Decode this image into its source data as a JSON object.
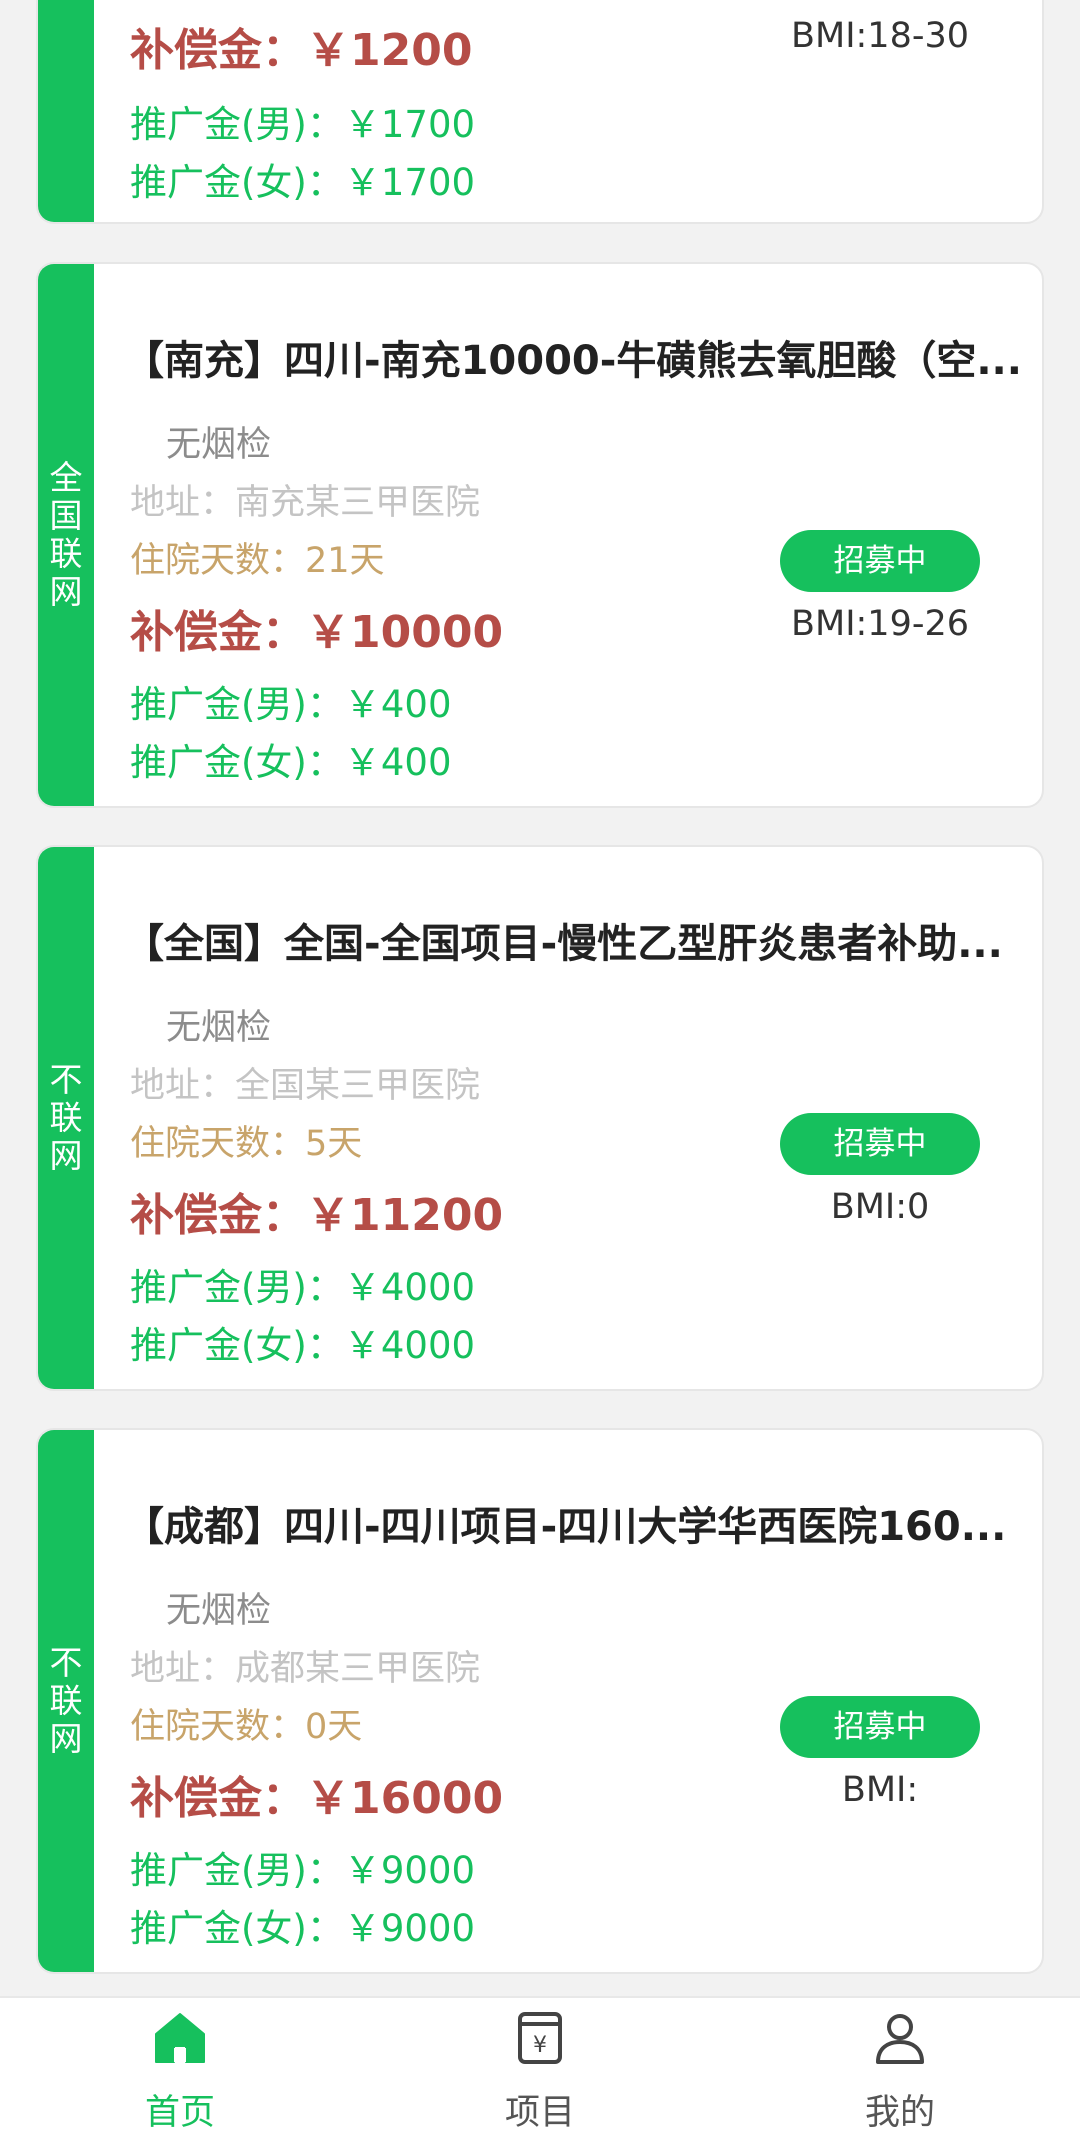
{
  "cards": [
    {
      "side_tag": "",
      "compensation": "补偿金：￥1200",
      "status": "",
      "bmi": "BMI:18-30",
      "promo_male": "推广金(男)：￥1700",
      "promo_female": "推广金(女)：￥1700"
    },
    {
      "side_tag": "全国联网",
      "title": "【南充】四川-南充10000-牛磺熊去氧胆酸（空...",
      "smoke_check": "无烟检",
      "address": "地址：南充某三甲医院",
      "hospital_days": "住院天数：21天",
      "compensation": "补偿金：￥10000",
      "promo_male": "推广金(男)：￥400",
      "promo_female": "推广金(女)：￥400",
      "status": "招募中",
      "bmi": "BMI:19-26"
    },
    {
      "side_tag": "不联网",
      "title": "【全国】全国-全国项目-慢性乙型肝炎患者补助...",
      "smoke_check": "无烟检",
      "address": "地址：全国某三甲医院",
      "hospital_days": "住院天数：5天",
      "compensation": "补偿金：￥11200",
      "promo_male": "推广金(男)：￥4000",
      "promo_female": "推广金(女)：￥4000",
      "status": "招募中",
      "bmi": "BMI:0"
    },
    {
      "side_tag": "不联网",
      "title": "【成都】四川-四川项目-四川大学华西医院160...",
      "smoke_check": "无烟检",
      "address": "地址：成都某三甲医院",
      "hospital_days": "住院天数：0天",
      "compensation": "补偿金：￥16000",
      "promo_male": "推广金(男)：￥9000",
      "promo_female": "推广金(女)：￥9000",
      "status": "招募中",
      "bmi": "BMI:"
    }
  ],
  "tabbar": {
    "items": [
      {
        "label": "首页",
        "icon": "home-icon",
        "active": true
      },
      {
        "label": "项目",
        "icon": "project-document-icon",
        "active": false
      },
      {
        "label": "我的",
        "icon": "user-icon",
        "active": false
      }
    ],
    "active_color": "#16c05d"
  },
  "colors": {
    "accent": "#16c05d",
    "compensation": "#b54d47",
    "hospital_days": "#c8a46a",
    "address": "#c4c4c4"
  }
}
